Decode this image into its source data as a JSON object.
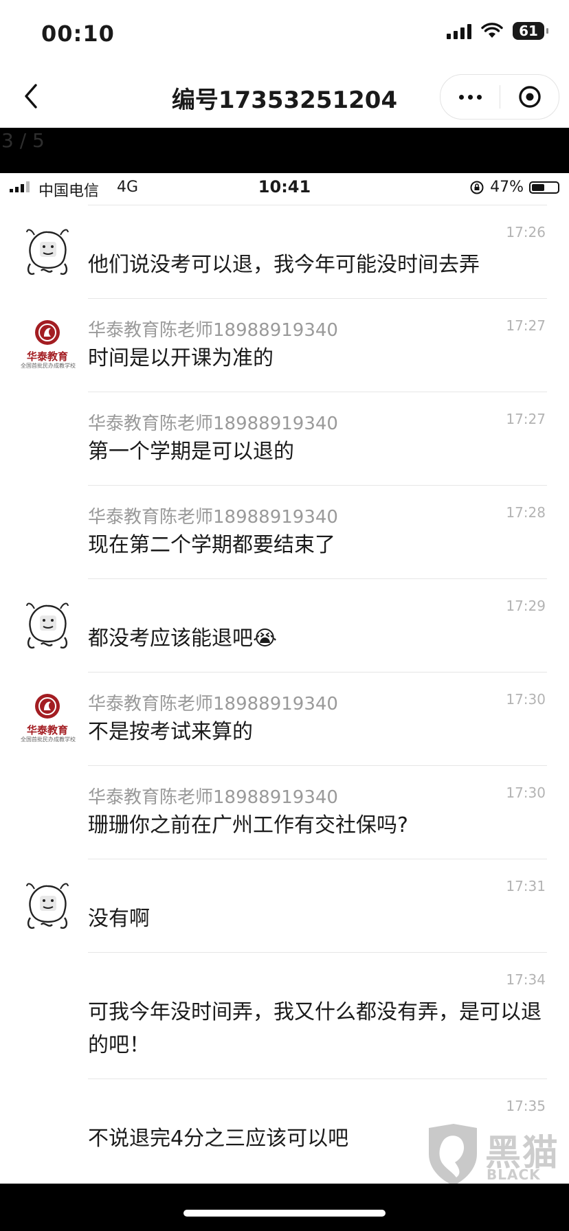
{
  "os_status": {
    "time": "00:10",
    "battery": "61"
  },
  "nav": {
    "title": "编号17353251204"
  },
  "viewer": {
    "page_indicator": "3 / 5"
  },
  "inner_status": {
    "carrier": "中国电信",
    "network": "4G",
    "time": "10:41",
    "battery": "47%"
  },
  "messages": [
    {
      "avatar": "meme-face",
      "sender": "",
      "time": "17:26",
      "text": "他们说没考可以退，我今年可能没时间去弄"
    },
    {
      "avatar": "school-logo",
      "sender": "华泰教育陈老师18988919340",
      "time": "17:27",
      "text": "时间是以开课为准的"
    },
    {
      "avatar": "",
      "sender": "华泰教育陈老师18988919340",
      "time": "17:27",
      "text": "第一个学期是可以退的"
    },
    {
      "avatar": "",
      "sender": "华泰教育陈老师18988919340",
      "time": "17:28",
      "text": "现在第二个学期都要结束了"
    },
    {
      "avatar": "meme-face",
      "sender": "",
      "time": "17:29",
      "text": "都没考应该能退吧😭"
    },
    {
      "avatar": "school-logo",
      "sender": "华泰教育陈老师18988919340",
      "time": "17:30",
      "text": "不是按考试来算的"
    },
    {
      "avatar": "",
      "sender": "华泰教育陈老师18988919340",
      "time": "17:30",
      "text": "珊珊你之前在广州工作有交社保吗?"
    },
    {
      "avatar": "meme-face",
      "sender": "",
      "time": "17:31",
      "text": "没有啊"
    },
    {
      "avatar": "",
      "sender": "",
      "time": "17:34",
      "text": "可我今年没时间弄，我又什么都没有弄，是可以退的吧！"
    },
    {
      "avatar": "",
      "sender": "",
      "time": "17:35",
      "text": "不说退完4分之三应该可以吧"
    }
  ],
  "logo": {
    "name": "华泰教育",
    "caption": "全国首批民办成教学校"
  },
  "watermark": {
    "title": "黑猫",
    "subtitle": "BLACK CAT"
  }
}
